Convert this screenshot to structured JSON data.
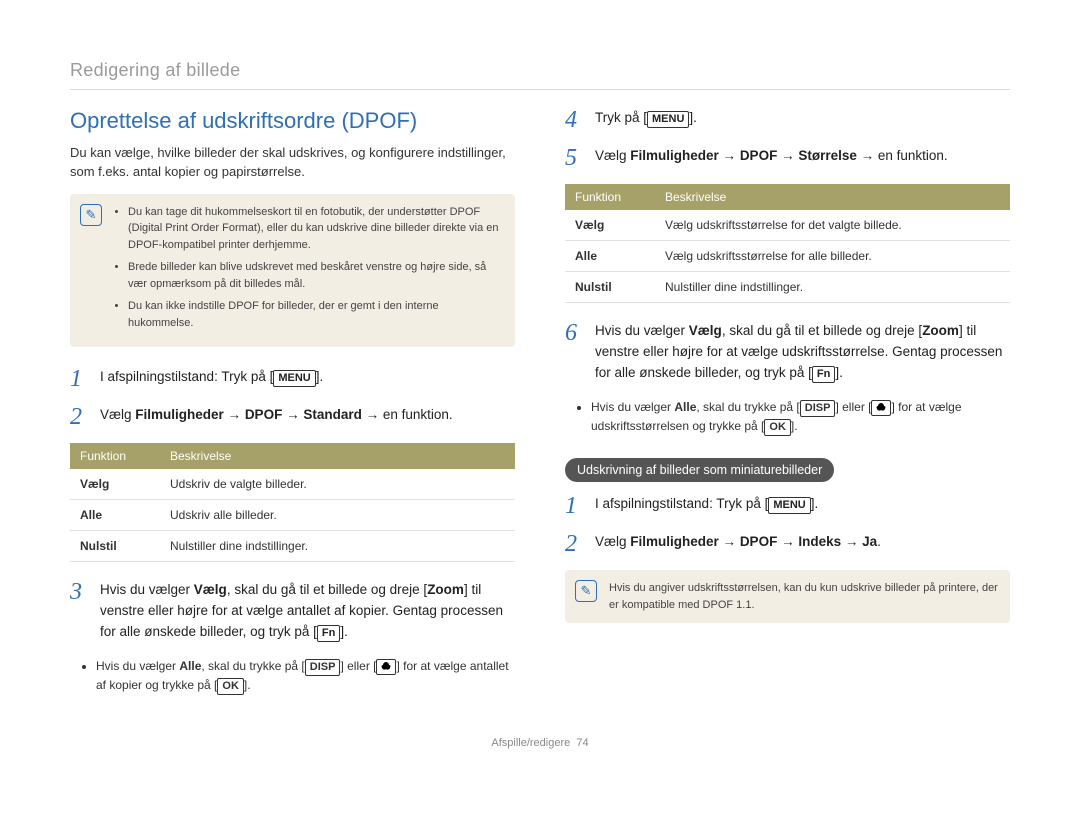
{
  "breadcrumb": "Redigering af billede",
  "section_title": "Oprettelse af udskriftsordre (DPOF)",
  "intro": "Du kan vælge, hvilke billeder der skal udskrives, og konfigurere indstillinger, som f.eks. antal kopier og papirstørrelse.",
  "note_icon_glyph": "✎",
  "note1": {
    "items": [
      "Du kan tage dit hukommelseskort til en fotobutik, der understøtter DPOF (Digital Print Order Format), eller du kan udskrive dine billeder direkte via en DPOF-kompatibel printer derhjemme.",
      "Brede billeder kan blive udskrevet med beskåret venstre og højre side, så vær opmærksom på dit billedes mål.",
      "Du kan ikke indstille DPOF for billeder, der er gemt i den interne hukommelse."
    ]
  },
  "left": {
    "step1_pre": "I afspilningstilstand: Tryk på [",
    "step1_key": "MENU",
    "step1_post": "].",
    "step2_a": "Vælg ",
    "step2_b": "Filmuligheder",
    "step2_c": " → ",
    "step2_d": "DPOF",
    "step2_e": " → ",
    "step2_f": "Standard",
    "step2_g": " → en funktion.",
    "table_h1": "Funktion",
    "table_h2": "Beskrivelse",
    "rows": [
      {
        "f": "Vælg",
        "d": "Udskriv de valgte billeder."
      },
      {
        "f": "Alle",
        "d": "Udskriv alle billeder."
      },
      {
        "f": "Nulstil",
        "d": "Nulstiller dine indstillinger."
      }
    ],
    "step3_a": "Hvis du vælger ",
    "step3_b": "Vælg",
    "step3_c": ", skal du gå til et billede og dreje [",
    "step3_d": "Zoom",
    "step3_e": "] til venstre eller højre for at vælge antallet af kopier. Gentag processen for alle ønskede billeder, og tryk på [",
    "step3_f": "Fn",
    "step3_g": "].",
    "sub_a": "Hvis du vælger ",
    "sub_b": "Alle",
    "sub_c": ", skal du trykke på [",
    "sub_d": "DISP",
    "sub_e": "] eller [",
    "sub_f": "] for at vælge antallet af kopier og trykke på [",
    "sub_g": "OK",
    "sub_h": "]."
  },
  "right": {
    "step4_pre": "Tryk på [",
    "step4_key": "MENU",
    "step4_post": "].",
    "step5_a": "Vælg ",
    "step5_b": "Filmuligheder",
    "step5_c": " → ",
    "step5_d": "DPOF",
    "step5_e": " → ",
    "step5_f": "Størrelse",
    "step5_g": " → en funktion.",
    "table_h1": "Funktion",
    "table_h2": "Beskrivelse",
    "rows": [
      {
        "f": "Vælg",
        "d": "Vælg udskriftsstørrelse for det valgte billede."
      },
      {
        "f": "Alle",
        "d": "Vælg udskriftsstørrelse for alle billeder."
      },
      {
        "f": "Nulstil",
        "d": "Nulstiller dine indstillinger."
      }
    ],
    "step6_a": "Hvis du vælger ",
    "step6_b": "Vælg",
    "step6_c": ", skal du gå til et billede og dreje [",
    "step6_d": "Zoom",
    "step6_e": "] til venstre eller højre for at vælge udskriftsstørrelse. Gentag processen for alle ønskede billeder, og tryk på [",
    "step6_f": "Fn",
    "step6_g": "].",
    "sub_a": "Hvis du vælger ",
    "sub_b": "Alle",
    "sub_c": ", skal du trykke på [",
    "sub_d": "DISP",
    "sub_e": "] eller [",
    "sub_f": "] for at vælge udskriftsstørrelsen og trykke på [",
    "sub_g": "OK",
    "sub_h": "].",
    "pill": "Udskrivning af billeder som miniaturebilleder",
    "tstep1_pre": "I afspilningstilstand: Tryk på [",
    "tstep1_key": "MENU",
    "tstep1_post": "].",
    "tstep2_a": "Vælg ",
    "tstep2_b": "Filmuligheder",
    "tstep2_c": " → ",
    "tstep2_d": "DPOF",
    "tstep2_e": " → ",
    "tstep2_f": "Indeks",
    "tstep2_g": " → ",
    "tstep2_h": "Ja",
    "tstep2_i": ".",
    "note2": "Hvis du angiver udskriftsstørrelsen, kan du kun udskrive billeder på printere, der er kompatible med DPOF 1.1."
  },
  "footer_label": "Afspille/redigere",
  "footer_page": "74"
}
